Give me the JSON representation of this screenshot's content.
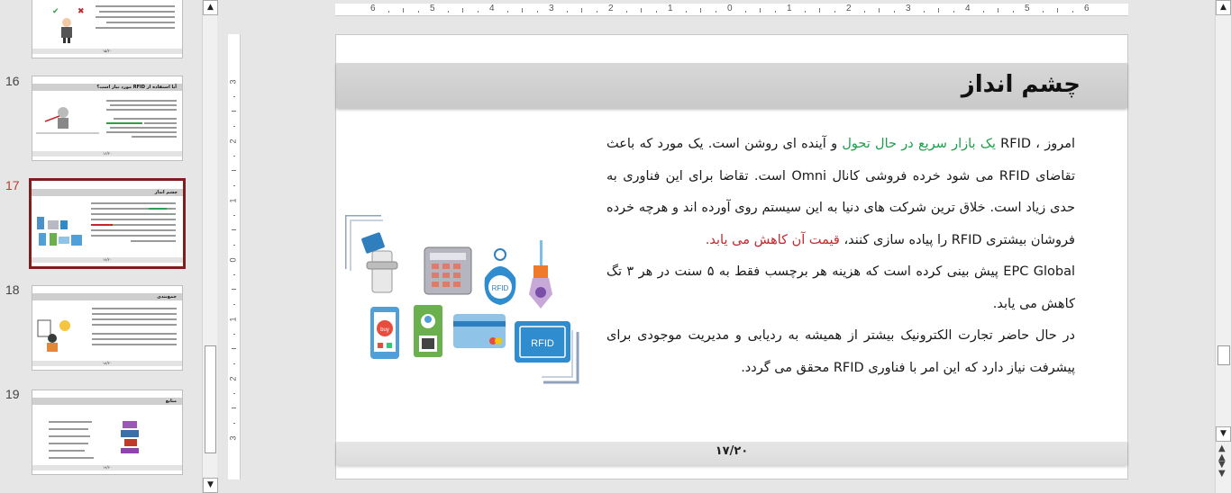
{
  "thumbnails": {
    "slides": [
      {
        "number": "",
        "title": ""
      },
      {
        "number": "16",
        "title": "آیا استفاده از RFID مورد نیاز است؟"
      },
      {
        "number": "17",
        "title": "چشم انداز"
      },
      {
        "number": "18",
        "title": "جمع‌بندی"
      },
      {
        "number": "19",
        "title": "منابع"
      }
    ],
    "footer_prev": "۱۵/۲۰",
    "footer_16": "۱۶/۲۰",
    "footer_17": "۱۷/۲۰",
    "footer_18": "۱۸/۲۰",
    "footer_19": "۱۹/۲۰"
  },
  "ruler": {
    "horizontal": [
      "6",
      "5",
      "4",
      "3",
      "2",
      "1",
      "0",
      "1",
      "2",
      "3",
      "4",
      "5",
      "6"
    ],
    "vertical": [
      "3",
      "2",
      "1",
      "0",
      "1",
      "2",
      "3"
    ]
  },
  "slide": {
    "title": "چشم انداز",
    "p1_a": "امروز ، RFID ",
    "p1_green": "یک بازار سریع در حال تحول",
    "p1_b": " و آینده ای روشن است. یک مورد که باعث تقاضای RFID می شود خرده فروشی کانال Omni است. تقاضا برای این فناوری به حدی زیاد است. خلاق ترین شرکت های دنیا به این سیستم روی آورده اند و هرچه خرده فروشان بیشتری RFID را پیاده سازی کنند، ",
    "p1_red": "قیمت آن کاهش می یابد.",
    "p2": "EPC Global پیش بینی کرده است که هزینه هر برچسب فقط به ۵ سنت در هر ۳ تگ کاهش می یابد.",
    "p3": "در حال حاضر تجارت الکترونیک بیشتر از همیشه به ردیابی و مدیریت موجودی برای پیشرفت نیاز دارد که این امر با فناوری RFID محقق می گردد.",
    "page_number": "۱۷/۲۰",
    "illustration_labels": {
      "tag_text": "RFID",
      "card_text": "RFID",
      "phone_text": "buy"
    }
  },
  "colors": {
    "accent_green": "#1e9e4a",
    "accent_red": "#c0282c",
    "selection_border": "#7d1f1f",
    "header_gray": "#d0d0d0"
  }
}
